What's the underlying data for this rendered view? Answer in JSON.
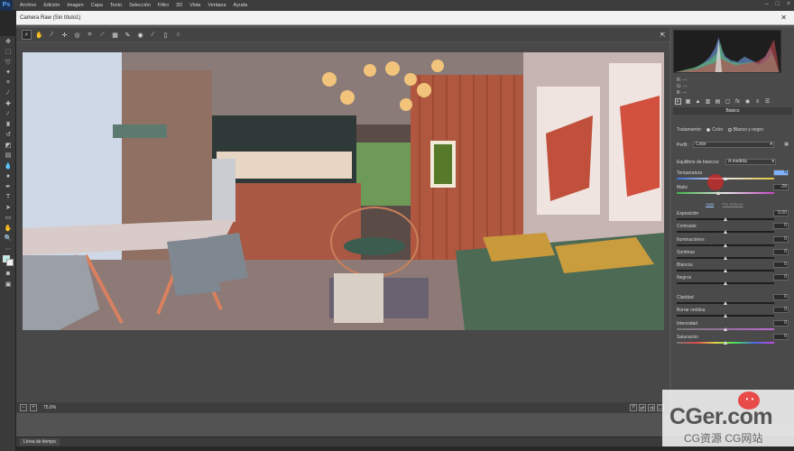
{
  "app": {
    "logo": "Ps",
    "menu": [
      "Archivo",
      "Edición",
      "Imagen",
      "Capa",
      "Texto",
      "Selección",
      "Filtro",
      "3D",
      "Vista",
      "Ventana",
      "Ayuda"
    ]
  },
  "dialog": {
    "title": "Camera Raw (Sin título1)"
  },
  "histogram": {
    "r_label": "R:",
    "g_label": "G:",
    "b_label": "B:",
    "r_value": "---",
    "g_value": "---",
    "b_value": "---"
  },
  "basic_panel": {
    "header": "Básico",
    "treatment_label": "Tratamiento:",
    "treatment_color": "Color",
    "treatment_bw": "Blanco y negro",
    "profile_label": "Perfil:",
    "profile_value": "Color",
    "wb_label": "Equilibrio de blancos:",
    "wb_value": "A medida",
    "temperature_label": "Temperatura",
    "temperature_value": "0",
    "tint_label": "Matiz",
    "tint_value": "-28",
    "auto_link": "Auto",
    "default_link": "Por defecto",
    "sliders": [
      {
        "label": "Exposición",
        "value": "0,00"
      },
      {
        "label": "Contraste",
        "value": "0"
      },
      {
        "label": "Iluminaciones",
        "value": "0"
      },
      {
        "label": "Sombras",
        "value": "0"
      },
      {
        "label": "Blancos",
        "value": "0"
      },
      {
        "label": "Negros",
        "value": "0"
      },
      {
        "label": "Claridad",
        "value": "0"
      },
      {
        "label": "Borrar neblina",
        "value": "0"
      },
      {
        "label": "Intensidad",
        "value": "0"
      },
      {
        "label": "Saturación",
        "value": "0"
      }
    ]
  },
  "bottom": {
    "zoom": "75,6%",
    "timeline_tab": "Línea de tiempo"
  },
  "watermark": {
    "main": "CGer.com",
    "sub": "CG资源 CG网站"
  }
}
